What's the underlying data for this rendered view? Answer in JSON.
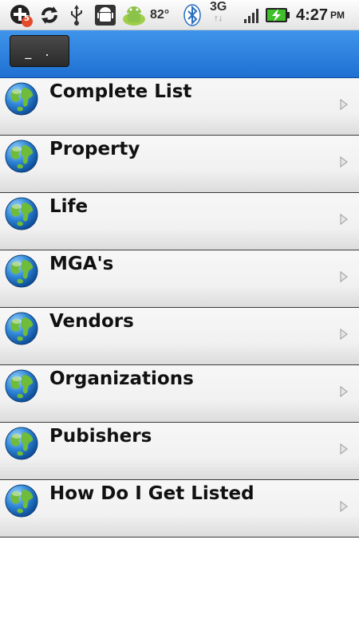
{
  "status_bar": {
    "notification_count": "5",
    "temperature": "82°",
    "network": "3G",
    "network_arrows": "↑↓",
    "time": "4:27",
    "ampm": "PM"
  },
  "title_bar": {
    "back_label": "_ ."
  },
  "menu": {
    "items": [
      {
        "label": "Complete List",
        "icon": "globe-icon"
      },
      {
        "label": "Property",
        "icon": "globe-icon"
      },
      {
        "label": "Life",
        "icon": "globe-icon"
      },
      {
        "label": "MGA's",
        "icon": "globe-icon"
      },
      {
        "label": "Vendors",
        "icon": "globe-icon"
      },
      {
        "label": "Organizations",
        "icon": "globe-icon"
      },
      {
        "label": "Pubishers",
        "icon": "globe-icon"
      },
      {
        "label": "How Do I Get Listed",
        "icon": "globe-icon"
      }
    ]
  },
  "colors": {
    "title_bar": "#2a7fe0",
    "row_background": "#f3f3f3",
    "divider": "#3a3a3a"
  }
}
